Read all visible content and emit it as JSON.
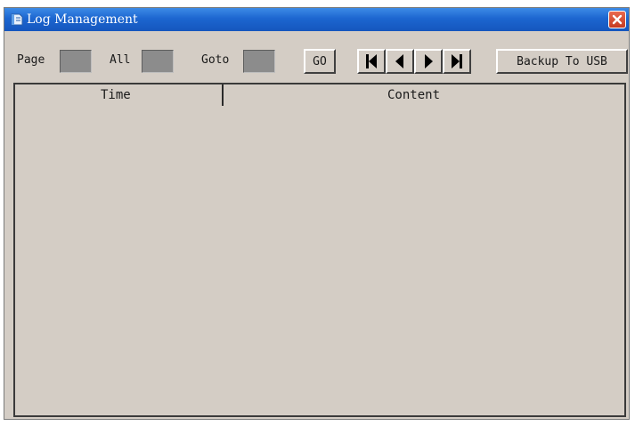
{
  "window": {
    "title": "Log Management",
    "icons": {
      "app": "log-book-icon",
      "close": "close-icon"
    },
    "colors": {
      "titlebar": "#1c66d0",
      "body": "#d4cdc5",
      "close": "#d24a2e"
    }
  },
  "toolbar": {
    "page_label": "Page",
    "page_value": "",
    "all_label": "All",
    "all_value": "",
    "goto_label": "Goto",
    "goto_value": "",
    "go_button": "GO",
    "nav_icons": [
      "first-page-icon",
      "previous-page-icon",
      "next-page-icon",
      "last-page-icon"
    ],
    "backup_button": "Backup To USB"
  },
  "log_table": {
    "columns": [
      "Time",
      "Content"
    ],
    "rows": []
  }
}
